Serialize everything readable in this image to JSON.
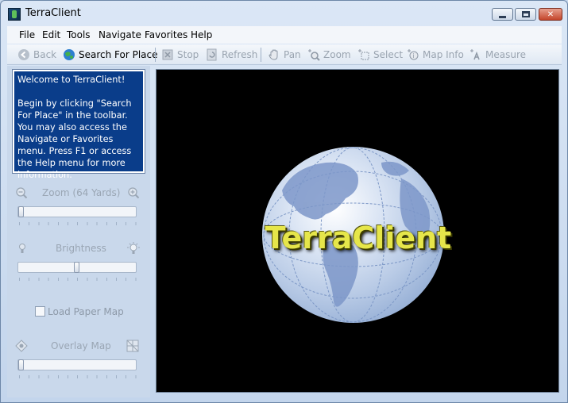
{
  "window": {
    "title": "TerraClient"
  },
  "menu": [
    "File",
    "Edit",
    "Tools",
    "Navigate",
    "Favorites",
    "Help"
  ],
  "toolbar": {
    "back": "Back",
    "search": "Search For Place",
    "stop": "Stop",
    "refresh": "Refresh",
    "pan": "Pan",
    "zoom": "Zoom",
    "select": "Select",
    "map_info": "Map Info",
    "measure": "Measure"
  },
  "welcome": {
    "heading": "Welcome to TerraClient!",
    "body": "Begin by clicking \"Search For Place\" in the toolbar. You may also access the Navigate or Favorites menu. Press F1 or access the Help menu for more information."
  },
  "controls": {
    "zoom_label": "Zoom (64 Yards)",
    "brightness_label": "Brightness",
    "load_paper_map": "Load Paper Map",
    "overlay_map": "Overlay Map",
    "zoom_level": 0.0,
    "brightness_level": 0.5,
    "overlay_level": 0.0
  },
  "map": {
    "brand_text": "TerraClient"
  }
}
